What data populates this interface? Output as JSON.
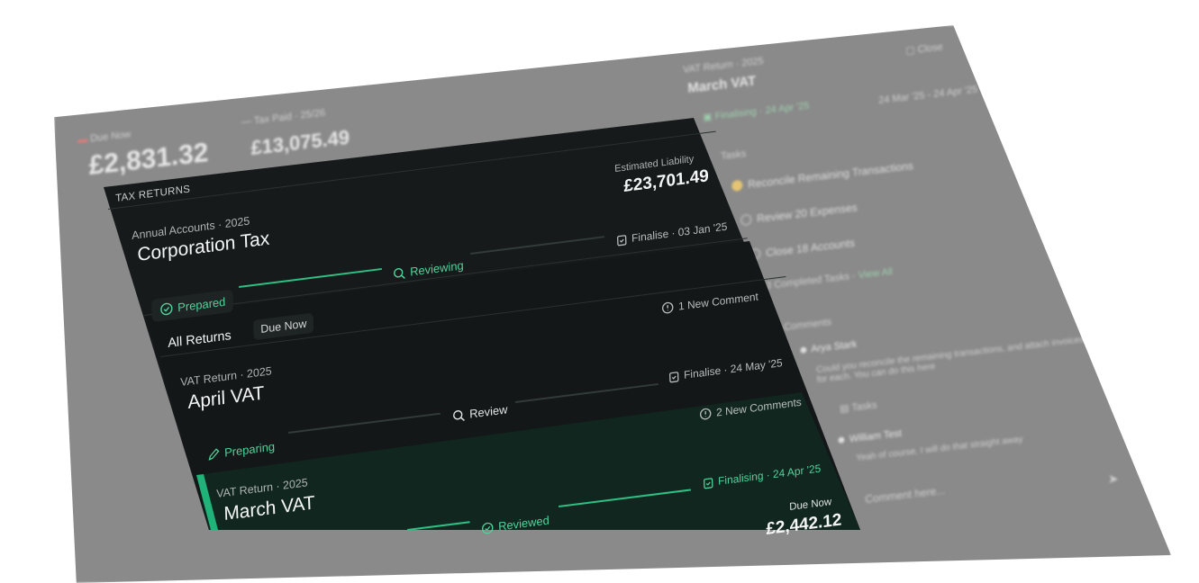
{
  "back": {
    "due_now_label": "Due Now",
    "due_now_amount": "£2,831.32",
    "tax_paid_label": "Tax Paid · 25/26",
    "tax_paid_amount": "£13,075.49",
    "detail_subtitle": "VAT Return · 2025",
    "detail_title": "March VAT",
    "close_label": "Close",
    "date_range": "24 Mar '25 - 24 Apr '25",
    "status": "Finalising · 24 Apr '25",
    "tasks_heading": "Tasks",
    "tasks": [
      "Reconcile Remaining Transactions",
      "Review 20 Expenses",
      "Close 18 Accounts"
    ],
    "completed_tasks": "3 Completed Tasks",
    "view_all": "View All",
    "comments_heading": "Comments",
    "comments": [
      {
        "author": "Arya Stark",
        "text": "Could you reconcile the remaining transactions, and attach invoices for each. You can do this here",
        "chip": "Tasks"
      },
      {
        "author": "William Test",
        "text": "Yeah of course, I will do that straight away"
      }
    ],
    "comment_placeholder": "Comment here..."
  },
  "front": {
    "section_label": "TAX RETURNS",
    "liability_label": "Estimated Liability",
    "liability_amount": "£23,701.49",
    "corp": {
      "subtitle": "Annual Accounts · 2025",
      "title": "Corporation Tax",
      "finalise": "Finalise · 03 Jan '25",
      "step1": "Prepared",
      "step2": "Reviewing",
      "comments": "1 New Comment"
    },
    "tabs": [
      "All Returns",
      "Due Now"
    ],
    "april": {
      "subtitle": "VAT Return · 2025",
      "title": "April VAT",
      "finalise": "Finalise · 24 May '25",
      "step1": "Preparing",
      "step2": "Review",
      "comments": "2 New Comments"
    },
    "march": {
      "subtitle": "VAT Return · 2025",
      "title": "March VAT",
      "finalising": "Finalising · 24 Apr '25",
      "step2": "Reviewed",
      "due_label": "Due Now",
      "due_amount": "£2,442.12"
    }
  }
}
